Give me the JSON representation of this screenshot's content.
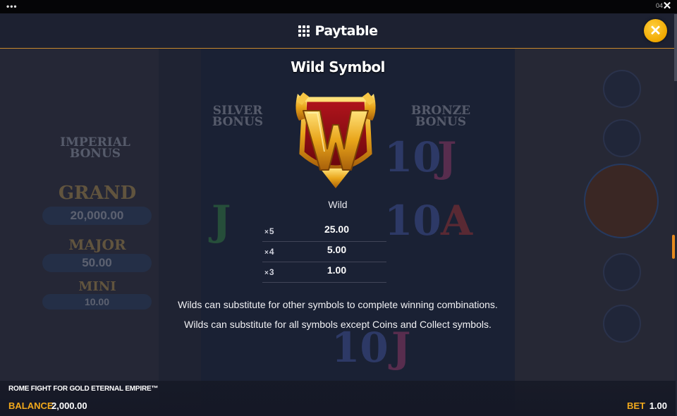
{
  "system_bar": {
    "clock": "04"
  },
  "header": {
    "title": "Paytable"
  },
  "background": {
    "bonuses": [
      "IMPERIAL BONUS",
      "SILVER BONUS",
      "BRONZE BONUS"
    ],
    "jackpots": [
      {
        "name": "GRAND",
        "value": "20,000.00"
      },
      {
        "name": "MAJOR",
        "value": "50.00"
      },
      {
        "name": "MINI",
        "value": "10.00"
      }
    ]
  },
  "section": {
    "title": "Wild Symbol",
    "symbol_name": "Wild",
    "payouts": [
      {
        "count": "5",
        "value": "25.00"
      },
      {
        "count": "4",
        "value": "5.00"
      },
      {
        "count": "3",
        "value": "1.00"
      }
    ],
    "descriptions": [
      "Wilds can substitute for other symbols to complete winning combinations.",
      "Wilds can substitute for all symbols except Coins and Collect symbols."
    ]
  },
  "footer": {
    "game_name": "ROME FIGHT FOR GOLD ETERNAL EMPIRE™",
    "balance_label": "BALANCE",
    "balance_value": "2,000.00",
    "bet_label": "BET",
    "bet_value": "1.00"
  },
  "colors": {
    "accent": "#f0a81c",
    "close_button": "#f5b300",
    "scroll_thumb": "#e58a1f"
  },
  "icons": [
    "more-dots-icon",
    "close-icon",
    "grid-menu-icon",
    "wild-w-symbol-icon"
  ]
}
